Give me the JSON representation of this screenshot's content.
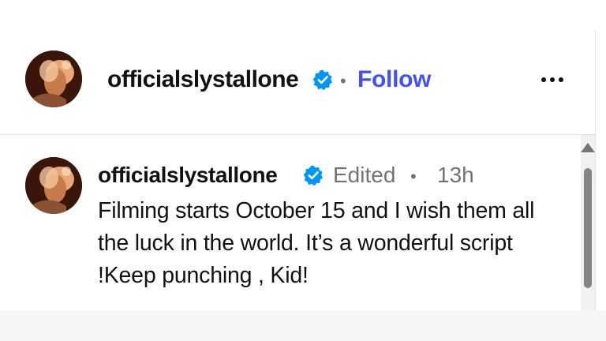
{
  "post_header": {
    "username": "officialslystallone",
    "verified_icon": "verified-badge-icon",
    "separator": "•",
    "follow_label": "Follow",
    "more_icon": "more-options-icon"
  },
  "caption": {
    "username": "officialslystallone",
    "verified_icon": "verified-badge-icon",
    "edited_label": "Edited",
    "separator": "•",
    "timestamp": "13h",
    "text": "Filming starts October 15 and I wish them all the luck in the world. It’s a wonderful script !Keep punching , Kid!"
  },
  "colors": {
    "follow_blue": "#4150f7",
    "verified_blue": "#0095f6",
    "meta_gray": "#737373"
  }
}
